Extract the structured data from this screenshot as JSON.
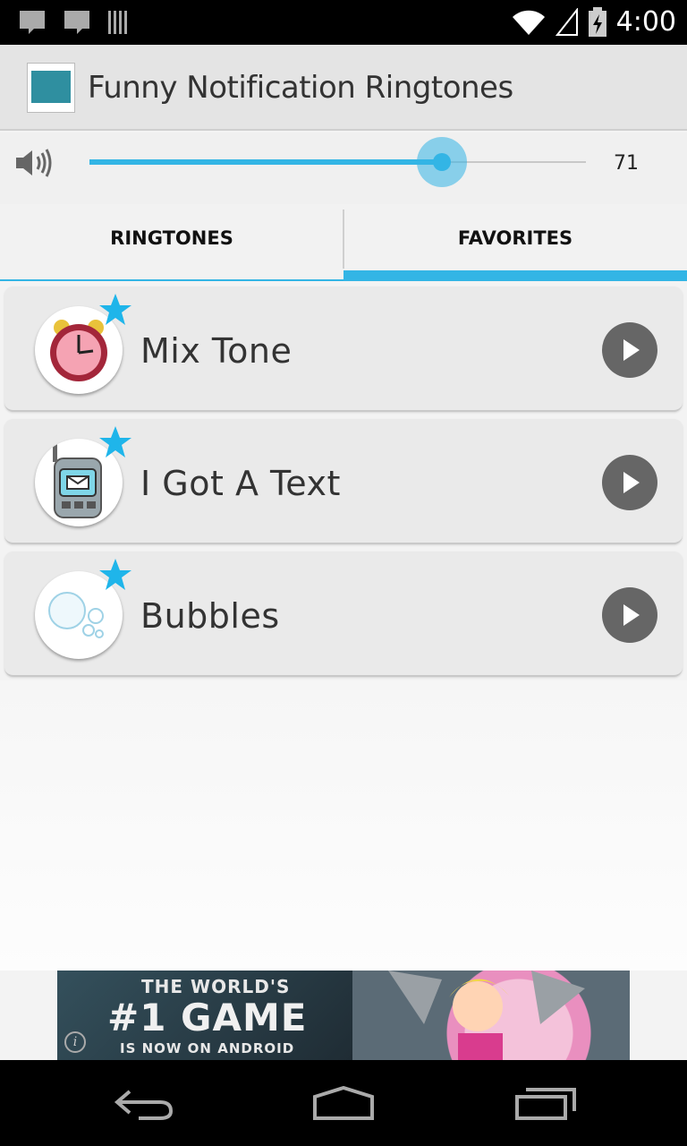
{
  "status_bar": {
    "time": "4:00",
    "icons": [
      "notification-icon",
      "chat-icon",
      "barcode-icon",
      "wifi-icon",
      "signal-icon",
      "battery-charging-icon"
    ]
  },
  "app": {
    "title": "Funny Notification Ringtones",
    "icon": "app-logo-icon"
  },
  "volume": {
    "icon": "speaker-icon",
    "value": "71",
    "level": 0.71,
    "accent": "#33b5e5"
  },
  "tabs": [
    {
      "label": "RINGTONES",
      "selected": false
    },
    {
      "label": "FAVORITES",
      "selected": true
    }
  ],
  "list": {
    "items": [
      {
        "label": "Mix Tone",
        "icon": "alarm-clock-icon",
        "favorite": true
      },
      {
        "label": "I Got A Text",
        "icon": "phone-message-icon",
        "favorite": true
      },
      {
        "label": "Bubbles",
        "icon": "bubbles-icon",
        "favorite": true
      }
    ]
  },
  "ad": {
    "line1": "THE WORLD'S",
    "line2": "#1 GAME",
    "line3": "IS NOW ON ANDROID",
    "info_icon": "info-icon"
  },
  "nav": {
    "icons": [
      "back-icon",
      "home-icon",
      "recents-icon"
    ]
  }
}
